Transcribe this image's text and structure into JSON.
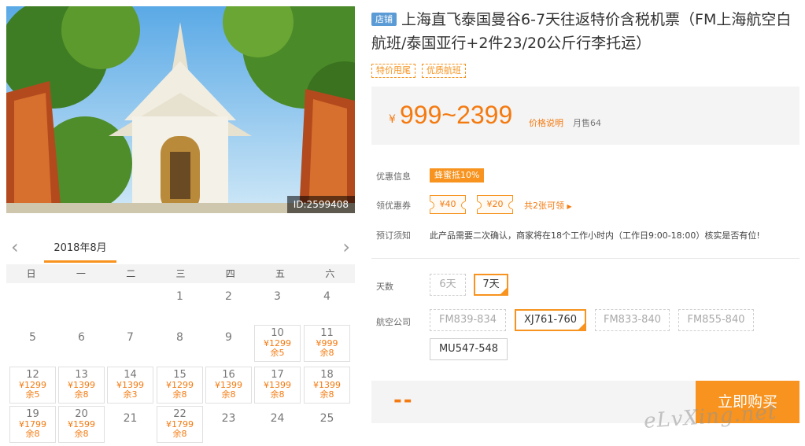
{
  "hero": {
    "id_label": "ID:2599408"
  },
  "calendar": {
    "month": "2018年8月",
    "prev_icon": "chevron-left-icon",
    "next_icon": "chevron-right-icon",
    "weekdays": [
      "日",
      "一",
      "二",
      "三",
      "四",
      "五",
      "六"
    ],
    "days": [
      {
        "day": "1"
      },
      {
        "day": "2"
      },
      {
        "day": "3"
      },
      {
        "day": "4"
      },
      {
        "day": "5"
      },
      {
        "day": "6"
      },
      {
        "day": "7"
      },
      {
        "day": "8"
      },
      {
        "day": "9"
      },
      {
        "day": "10",
        "price": "¥1299",
        "stock": "余5"
      },
      {
        "day": "11",
        "price": "¥999",
        "stock": "余8"
      },
      {
        "day": "12",
        "price": "¥1299",
        "stock": "余5"
      },
      {
        "day": "13",
        "price": "¥1399",
        "stock": "余8"
      },
      {
        "day": "14",
        "price": "¥1399",
        "stock": "余3"
      },
      {
        "day": "15",
        "price": "¥1299",
        "stock": "余8"
      },
      {
        "day": "16",
        "price": "¥1399",
        "stock": "余8"
      },
      {
        "day": "17",
        "price": "¥1399",
        "stock": "余8"
      },
      {
        "day": "18",
        "price": "¥1399",
        "stock": "余8"
      },
      {
        "day": "19",
        "price": "¥1799",
        "stock": "余8"
      },
      {
        "day": "20",
        "price": "¥1599",
        "stock": "余8"
      },
      {
        "day": "21"
      },
      {
        "day": "22",
        "price": "¥1799",
        "stock": "余8"
      },
      {
        "day": "23"
      },
      {
        "day": "24"
      },
      {
        "day": "25"
      }
    ]
  },
  "product": {
    "shop_badge": "店铺",
    "title": "上海直飞泰国曼谷6-7天往返特价含税机票（FM上海航空白航班/泰国亚行+2件23/20公斤行李托运）",
    "tags": [
      "特价甩尾",
      "优质航班"
    ],
    "price_symbol": "¥",
    "price_range": "999~2399",
    "price_note": "价格说明",
    "monthly_sales": "月售64"
  },
  "promo": {
    "label": "优惠信息",
    "badge": "蜂蜜抵10%"
  },
  "coupons": {
    "label": "领优惠券",
    "items": [
      "¥40",
      "¥20"
    ],
    "link": "共2张可领",
    "link_icon": "triangle-right-icon"
  },
  "booking": {
    "label": "预订须知",
    "text": "此产品需要二次确认，商家将在18个工作小时内（工作日9:00-18:00）核实是否有位!"
  },
  "days_option": {
    "label": "天数",
    "options": [
      {
        "label": "6天",
        "state": "disabled"
      },
      {
        "label": "7天",
        "state": "selected"
      }
    ]
  },
  "airline_option": {
    "label": "航空公司",
    "options": [
      {
        "label": "FM839-834",
        "state": "disabled"
      },
      {
        "label": "XJ761-760",
        "state": "selected"
      },
      {
        "label": "FM833-840",
        "state": "disabled"
      },
      {
        "label": "FM855-840",
        "state": "disabled"
      },
      {
        "label": "MU547-548",
        "state": "normal"
      }
    ]
  },
  "buy": {
    "total": "--",
    "button": "立即购买"
  },
  "watermark": "eLvXing.net"
}
